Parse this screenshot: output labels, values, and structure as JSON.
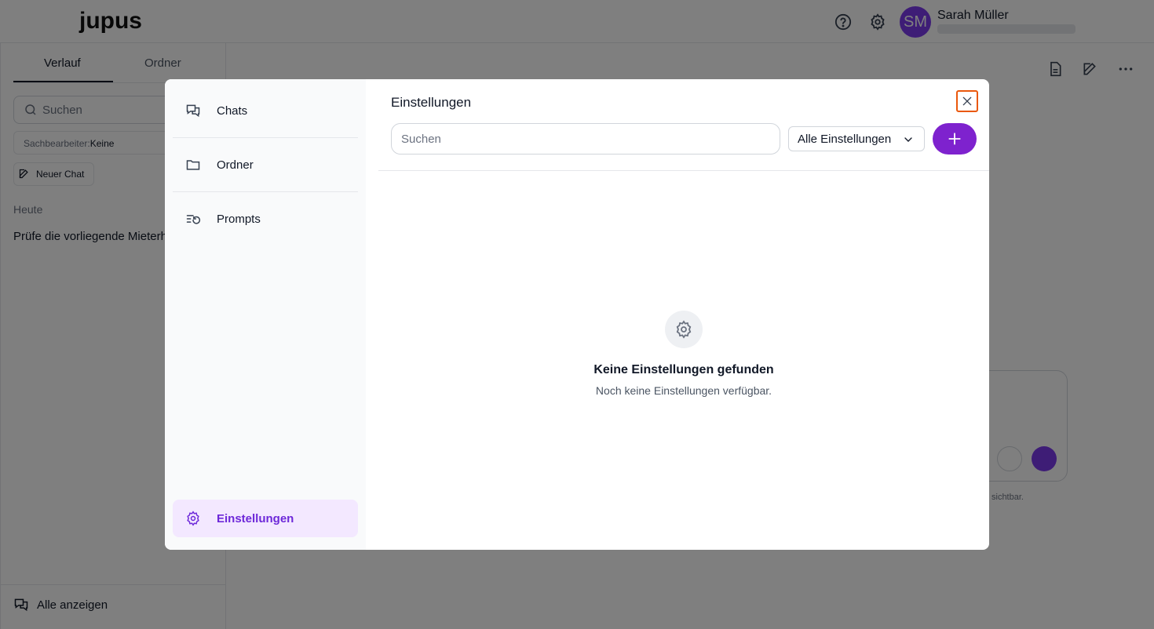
{
  "app": {
    "logo": "jupus",
    "user": {
      "initials": "SM",
      "name": "Sarah Müller"
    }
  },
  "sidebar": {
    "tabs": [
      "Verlauf",
      "Ordner"
    ],
    "search_placeholder": "Suchen",
    "filter_label": "Sachbearbeiter:",
    "filter_value": "Keine",
    "new_chat_label": "Neuer Chat",
    "group_label": "Heute",
    "chats": [
      "Prüfe die vorliegende Mieterh"
    ],
    "show_all_label": "Alle anzeigen"
  },
  "composer": {
    "hint_fragment": "sichtbar."
  },
  "modal": {
    "nav": [
      {
        "label": "Chats",
        "icon": "chats-icon"
      },
      {
        "label": "Ordner",
        "icon": "folder-icon"
      },
      {
        "label": "Prompts",
        "icon": "prompts-icon"
      },
      {
        "label": "Einstellungen",
        "icon": "gear-icon",
        "active": true
      }
    ],
    "title": "Einstellungen",
    "search_placeholder": "Suchen",
    "filter_value": "Alle Einstellungen",
    "empty_title": "Keine Einstellungen gefunden",
    "empty_subtitle": "Noch keine Einstellungen verfügbar."
  },
  "colors": {
    "accent": "#7e22ce",
    "active_nav_bg": "#f3e8ff",
    "focus_ring": "#ea580c",
    "overlay": "rgba(0,0,0,0.5)"
  }
}
